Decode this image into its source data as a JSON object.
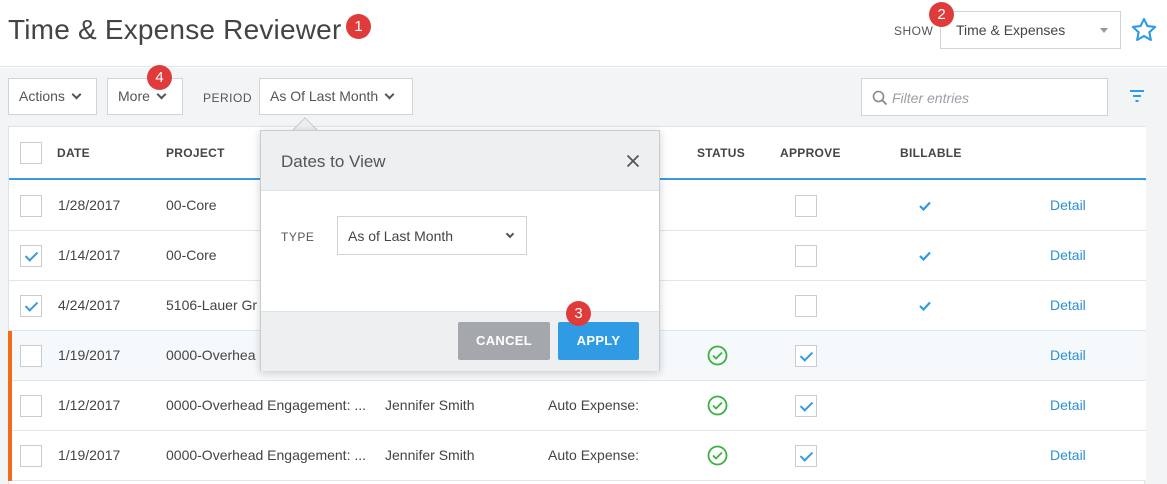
{
  "header": {
    "title": "Time & Expense Reviewer",
    "show_label": "SHOW",
    "show_value": "Time & Expenses"
  },
  "annotations": [
    "1",
    "2",
    "3",
    "4"
  ],
  "toolbar": {
    "actions_label": "Actions",
    "more_label": "More",
    "period_label": "PERIOD",
    "period_value": "As Of Last Month",
    "filter_placeholder": "Filter entries"
  },
  "table": {
    "columns": [
      "DATE",
      "PROJECT",
      "STATUS",
      "APPROVE",
      "BILLABLE"
    ],
    "rows": [
      {
        "checked": false,
        "date": "1/28/2017",
        "project": "00-Core",
        "person": "",
        "type": "",
        "status": false,
        "approve": false,
        "billable": true,
        "link": "Detail",
        "flag": false
      },
      {
        "checked": true,
        "date": "1/14/2017",
        "project": "00-Core",
        "person": "",
        "type": "",
        "status": false,
        "approve": false,
        "billable": true,
        "link": "Detail",
        "flag": false
      },
      {
        "checked": true,
        "date": "4/24/2017",
        "project": "5106-Lauer Gr",
        "person": "",
        "type": "",
        "status": false,
        "approve": false,
        "billable": true,
        "link": "Detail",
        "flag": false
      },
      {
        "checked": false,
        "date": "1/19/2017",
        "project": "0000-Overhea",
        "person": "",
        "type": "",
        "status": true,
        "approve": true,
        "billable": false,
        "link": "Detail",
        "flag": true
      },
      {
        "checked": false,
        "date": "1/12/2017",
        "project": "0000-Overhead Engagement: ...",
        "person": "Jennifer Smith",
        "type": "Auto Expense:",
        "status": true,
        "approve": true,
        "billable": false,
        "link": "Detail",
        "flag": true
      },
      {
        "checked": false,
        "date": "1/19/2017",
        "project": "0000-Overhead Engagement: ...",
        "person": "Jennifer Smith",
        "type": "Auto Expense:",
        "status": true,
        "approve": true,
        "billable": false,
        "link": "Detail",
        "flag": true
      }
    ]
  },
  "modal": {
    "title": "Dates to View",
    "type_label": "TYPE",
    "type_value": "As of Last Month",
    "cancel_label": "CANCEL",
    "apply_label": "APPLY"
  },
  "colors": {
    "accent": "#2f9be4",
    "badge": "#e03b3b",
    "flag": "#ef6c1a",
    "status_ok": "#3cb043"
  }
}
